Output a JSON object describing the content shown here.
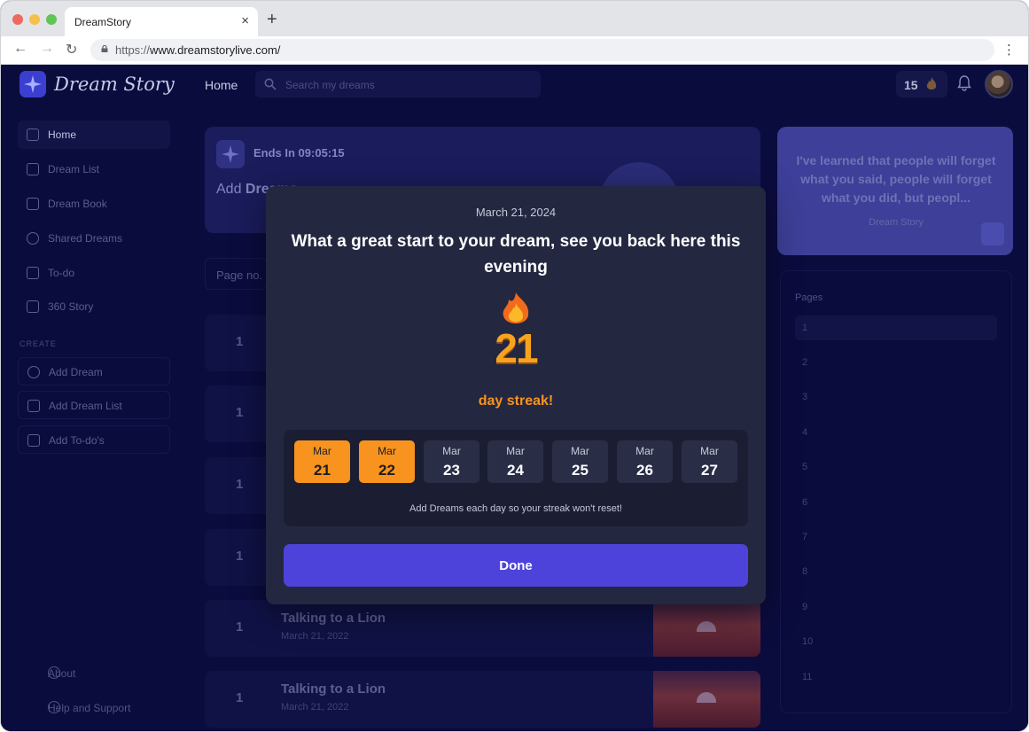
{
  "browser": {
    "tab_title": "DreamStory",
    "url_prefix": "https://",
    "url_host": "www.dreamstorylive.com/",
    "colors": {
      "close": "#ed6a5e",
      "minimize": "#f5bf4f",
      "maximize": "#61c554"
    }
  },
  "header": {
    "logo_text": "Dream Story",
    "home_label": "Home",
    "search_placeholder": "Search my dreams",
    "streak_count": "15"
  },
  "sidebar": {
    "items": [
      {
        "label": "Home",
        "icon": "home-icon"
      },
      {
        "label": "Dream List",
        "icon": "moon-cloud-icon"
      },
      {
        "label": "Dream Book",
        "icon": "book-icon"
      },
      {
        "label": "Shared Dreams",
        "icon": "share-circle-icon"
      },
      {
        "label": "To-do",
        "icon": "list-icon"
      },
      {
        "label": "360 Story",
        "icon": "open-book-icon"
      }
    ],
    "create_heading": "CREATE",
    "create_items": [
      {
        "label": "Add Dream",
        "icon": "moon-icon"
      },
      {
        "label": "Add Dream List",
        "icon": "moon-cloud-icon"
      },
      {
        "label": "Add To-do's",
        "icon": "list-icon"
      }
    ],
    "about": "About",
    "help": "Help and Support"
  },
  "main": {
    "banner": {
      "ends_in": "Ends In 09:05:15",
      "add_prefix": "Add ",
      "add_bold": "Dreams"
    },
    "page_no_label": "Page no.",
    "cards": [
      {
        "num": "1",
        "title": "",
        "date": ""
      },
      {
        "num": "1",
        "title": "",
        "date": ""
      },
      {
        "num": "1",
        "title": "",
        "date": ""
      },
      {
        "num": "1",
        "title": "",
        "date": ""
      },
      {
        "num": "1",
        "title": "Talking to a Lion",
        "date": "March 21, 2022"
      },
      {
        "num": "1",
        "title": "Talking to a Lion",
        "date": "March 21, 2022"
      }
    ]
  },
  "right_panel": {
    "quote": "I've learned that people will forget what you said, people will forget what you did, but peopl...",
    "quote_source": "Dream Story",
    "pages_title": "Pages",
    "pages": [
      "1",
      "2",
      "3",
      "4",
      "5",
      "6",
      "7",
      "8",
      "9",
      "10",
      "11"
    ]
  },
  "modal": {
    "date": "March 21, 2024",
    "title": "What a great start to your dream, see you back here this evening",
    "streak_number": "21",
    "streak_label": "day streak!",
    "days": [
      {
        "month": "Mar",
        "day": "21",
        "completed": true
      },
      {
        "month": "Mar",
        "day": "22",
        "completed": true
      },
      {
        "month": "Mar",
        "day": "23",
        "completed": false
      },
      {
        "month": "Mar",
        "day": "24",
        "completed": false
      },
      {
        "month": "Mar",
        "day": "25",
        "completed": false
      },
      {
        "month": "Mar",
        "day": "26",
        "completed": false
      },
      {
        "month": "Mar",
        "day": "27",
        "completed": false
      }
    ],
    "note": "Add Dreams each day so your streak won't reset!",
    "done_label": "Done",
    "accent_orange": "#f7931e",
    "button_color": "#4d43da"
  }
}
